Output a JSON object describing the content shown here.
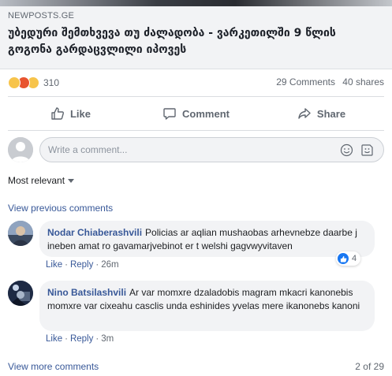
{
  "link": {
    "domain": "NEWPOSTS.GE",
    "headline": "უბედური შემთხვევა თუ ძალადობა - ვარკეთილში 9 წლის გოგონა გარდაცვლილი იპოვეს"
  },
  "stats": {
    "reaction_icons": [
      "sad-emoji-icon",
      "angry-emoji-icon",
      "wow-emoji-icon"
    ],
    "reaction_count": "310",
    "comments": "29 Comments",
    "shares": "40 shares"
  },
  "actions": {
    "like": "Like",
    "comment": "Comment",
    "share": "Share"
  },
  "composer": {
    "placeholder": "Write a comment..."
  },
  "sort": {
    "label": "Most relevant"
  },
  "view_previous": "View previous comments",
  "comments": [
    {
      "author": "Nodar Chiaberashvili",
      "text": "Policias ar aqlian mushaobas arhevnebze daarbe j ineben amat ro gavamarjvebinot er t welshi gagvwyvitaven",
      "like": "Like",
      "reply": "Reply",
      "time": "26m",
      "like_count": "4"
    },
    {
      "author": "Nino Batsilashvili",
      "text": "Ar var momxre dzaladobis magram mkacri kanonebis momxre var cixeahu casclis unda eshinides yvelas mere ikanonebs kanoni",
      "like": "Like",
      "reply": "Reply",
      "time": "3m"
    }
  ],
  "footer": {
    "view_more": "View more comments",
    "pagination": "2 of 29"
  },
  "colors": {
    "link_blue": "#385898",
    "meta_gray": "#606770",
    "bubble_bg": "#f2f3f5",
    "like_blue": "#1877f2"
  }
}
